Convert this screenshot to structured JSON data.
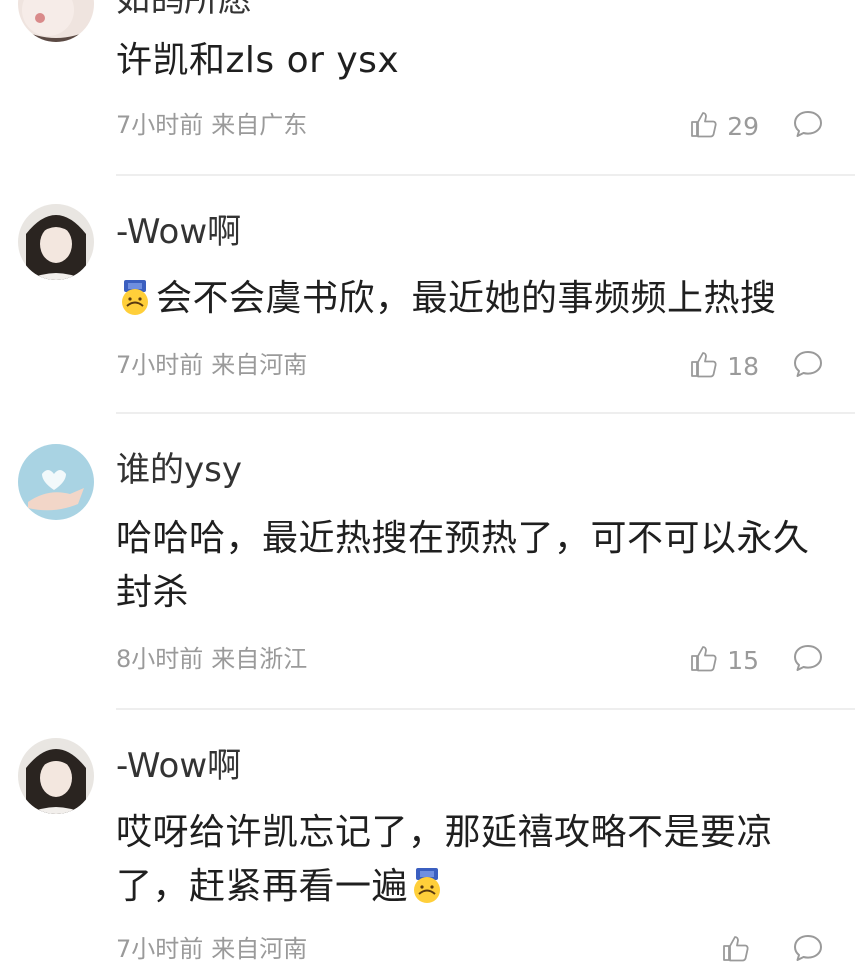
{
  "comments": [
    {
      "username": "如鸽所愿",
      "text": "许凯和zls or ysx",
      "time": "7小时前",
      "location": "来自广东",
      "likes": "29",
      "emoji": ""
    },
    {
      "username": "-Wow啊",
      "text": "会不会虞书欣，最近她的事频频上热搜",
      "time": "7小时前",
      "location": "来自河南",
      "likes": "18",
      "emoji": "upside-down-face-emoji"
    },
    {
      "username": "谁的ysy",
      "text": "哈哈哈，最近热搜在预热了，可不可以永久封杀",
      "time": "8小时前",
      "location": "来自浙江",
      "likes": "15",
      "emoji": ""
    },
    {
      "username": "-Wow啊",
      "text": "哎呀给许凯忘记了，那延禧攻略不是要凉了，赶紧再看一遍",
      "time": "7小时前",
      "location": "来自河南",
      "likes": "",
      "emoji": "upside-down-face-emoji"
    }
  ],
  "icons": {
    "like": "thumbs-up-icon",
    "reply": "speech-bubble-icon"
  },
  "colors": {
    "meta_text": "#9a9a9a",
    "divider": "#eeeeee",
    "body_text": "#1f1f1f"
  }
}
